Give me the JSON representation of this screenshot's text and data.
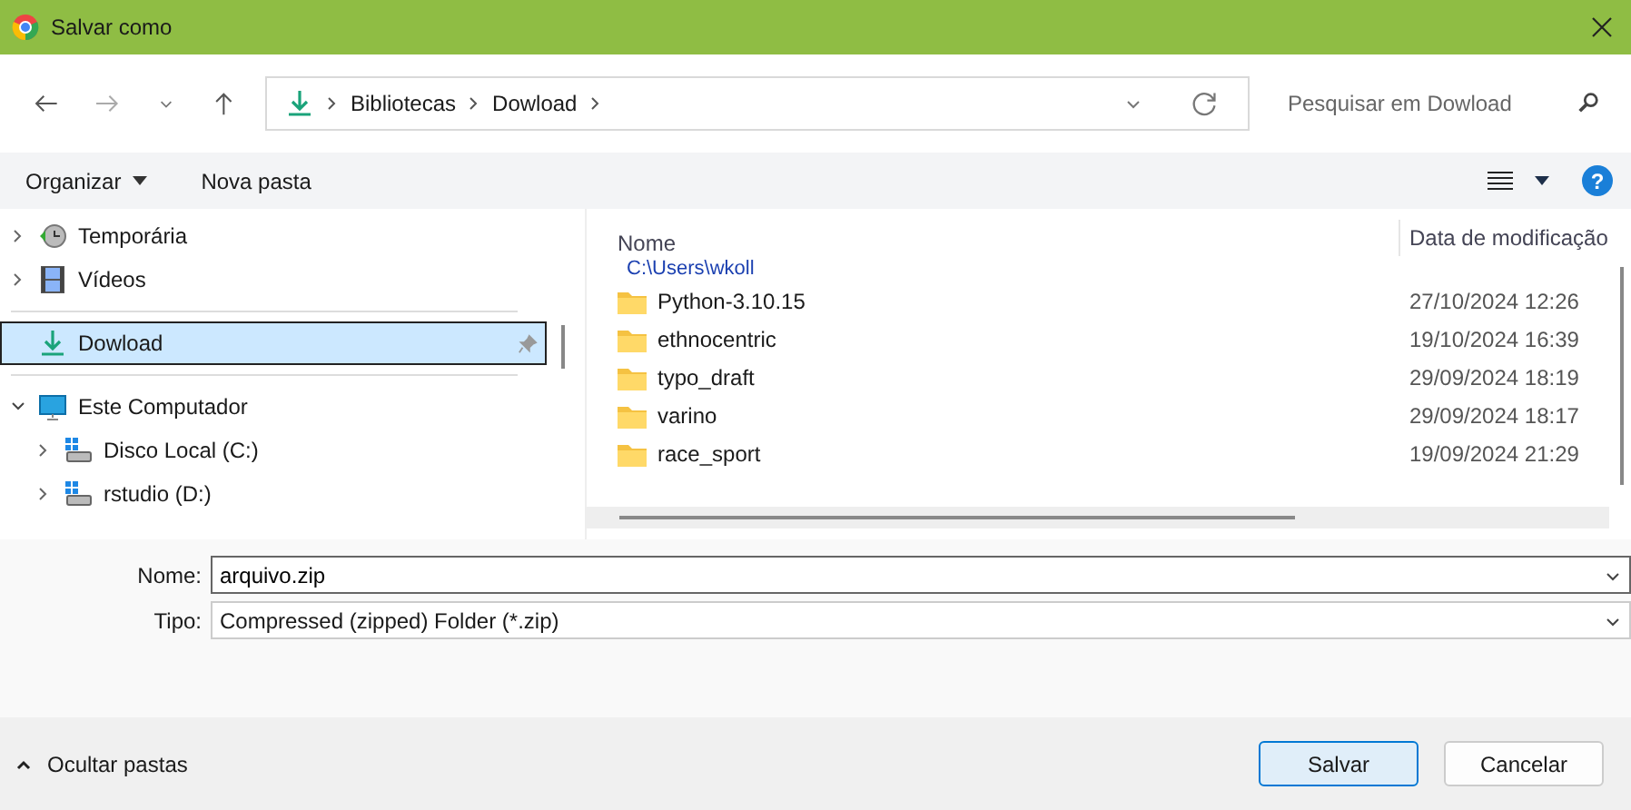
{
  "window": {
    "title": "Salvar como"
  },
  "address": {
    "crumbs": [
      "Bibliotecas",
      "Dowload"
    ]
  },
  "search": {
    "placeholder": "Pesquisar em Dowload"
  },
  "toolbar": {
    "organize": "Organizar",
    "new_folder": "Nova pasta",
    "help": "?"
  },
  "sidebar": {
    "groups": [
      {
        "items": [
          {
            "label": "Temporária",
            "kind": "clock",
            "expanded": false,
            "selected": false,
            "pinned": false
          },
          {
            "label": "Vídeos",
            "kind": "film",
            "expanded": false,
            "selected": false,
            "pinned": false
          }
        ]
      },
      {
        "items": [
          {
            "label": "Dowload",
            "kind": "download",
            "selected": true,
            "pinned": true
          }
        ]
      },
      {
        "items": [
          {
            "label": "Este Computador",
            "kind": "monitor",
            "expanded": true,
            "selected": false,
            "pinned": false,
            "children": [
              {
                "label": "Disco Local (C:)",
                "kind": "drive",
                "expanded": false,
                "selected": false,
                "pinned": false
              },
              {
                "label": "rstudio (D:)",
                "kind": "drive",
                "expanded": false,
                "selected": false,
                "pinned": false
              }
            ]
          }
        ]
      }
    ]
  },
  "files": {
    "columns": [
      "Nome",
      "Data de modificação"
    ],
    "path": "C:\\Users\\wkoll",
    "rows": [
      {
        "name": "Python-3.10.15",
        "modified": "27/10/2024 12:26"
      },
      {
        "name": "ethnocentric",
        "modified": "19/10/2024 16:39"
      },
      {
        "name": "typo_draft",
        "modified": "29/09/2024 18:19"
      },
      {
        "name": "varino",
        "modified": "29/09/2024 18:17"
      },
      {
        "name": "race_sport",
        "modified": "19/09/2024 21:29"
      }
    ]
  },
  "form": {
    "name_label": "Nome:",
    "name_value": "arquivo.zip",
    "type_label": "Tipo:",
    "type_value": "Compressed (zipped) Folder (*.zip)"
  },
  "footer": {
    "toggle": "Ocultar pastas",
    "buttons": [
      "Salvar",
      "Cancelar"
    ]
  }
}
